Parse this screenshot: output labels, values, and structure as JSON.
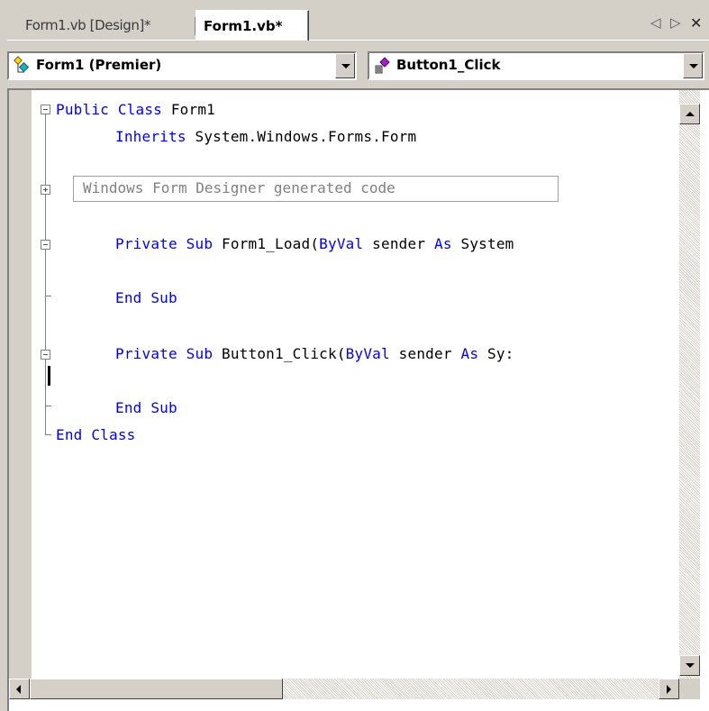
{
  "tabs": [
    {
      "label": "Form1.vb [Design]*",
      "active": false
    },
    {
      "label": "Form1.vb*",
      "active": true
    }
  ],
  "tab_nav": {
    "left_icon": "scroll-left-icon",
    "right_icon": "scroll-right-icon",
    "close_icon": "close-icon",
    "left": "◁",
    "right": "▷",
    "close": "✕"
  },
  "class_combo": {
    "value": "Form1 (Premier)",
    "icon": "class-icon"
  },
  "method_combo": {
    "value": "Button1_Click",
    "icon": "event-icon"
  },
  "code": {
    "line1": {
      "kw": "Public Class",
      "rest": " Form1"
    },
    "line2": {
      "kw": "Inherits",
      "rest": " System.Windows.Forms.Form"
    },
    "region": "Windows Form Designer generated code",
    "line4": {
      "kw1": "Private Sub",
      "t1": " Form1_Load(",
      "kw2": "ByVal",
      "t2": " sender ",
      "kw3": "As",
      "t3": " System"
    },
    "line5": {
      "kw": "End Sub"
    },
    "line6": {
      "kw1": "Private Sub",
      "t1": " Button1_Click(",
      "kw2": "ByVal",
      "t2": " sender ",
      "kw3": "As",
      "t3": " Sy:"
    },
    "line8": {
      "kw": "End Sub"
    },
    "line9": {
      "kw": "End Class"
    }
  },
  "colors": {
    "keyword": "#0000ff",
    "text": "#000000",
    "collapsed_region": "#808080",
    "chrome": "#d4d0c8"
  }
}
